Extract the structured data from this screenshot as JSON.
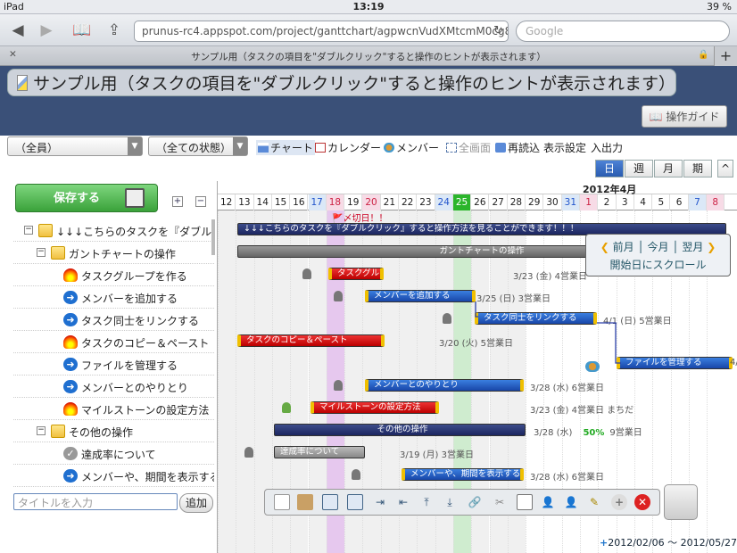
{
  "statusbar": {
    "device": "iPad",
    "time": "13:19",
    "battery": "39 %"
  },
  "browser": {
    "url": "prunus-rc4.appspot.com/project/ganttchart/agpwcnVudXMtcmM0cg8LE",
    "search_placeholder": "Google",
    "tab_title": "サンプル用（タスクの項目を\"ダブルクリック\"すると操作のヒントが表示されます）"
  },
  "banner": {
    "title": "サンプル用（タスクの項目を\"ダブルクリック\"すると操作のヒントが表示されます）",
    "guide_label": "操作ガイド"
  },
  "toolbar": {
    "member_filter": "（全員）",
    "status_filter": "（全ての状態）",
    "chart": "チャート",
    "calendar": "カレンダー",
    "member": "メンバー",
    "fullscreen": "全画面",
    "reload": "再読込",
    "display_settings": "表示設定",
    "import_export": "入出力",
    "views": [
      "日",
      "週",
      "月",
      "期"
    ],
    "collapse": "^"
  },
  "left": {
    "save_label": "保存する",
    "expand_label": "+",
    "collapse_label": "−",
    "title_placeholder": "タイトルを入力",
    "add_label": "追加"
  },
  "tree": [
    {
      "label": "↓↓↓こちらのタスクを『ダブル",
      "type": "group",
      "indent": 0
    },
    {
      "label": "ガントチャートの操作",
      "type": "group",
      "indent": 1
    },
    {
      "label": "タスクグループを作る",
      "type": "fire",
      "indent": 2
    },
    {
      "label": "メンバーを追加する",
      "type": "arrow",
      "indent": 2
    },
    {
      "label": "タスク同士をリンクする",
      "type": "arrow",
      "indent": 2
    },
    {
      "label": "タスクのコピー＆ペースト",
      "type": "fire",
      "indent": 2
    },
    {
      "label": "ファイルを管理する",
      "type": "arrow",
      "indent": 2
    },
    {
      "label": "メンバーとのやりとり",
      "type": "arrow",
      "indent": 2
    },
    {
      "label": "マイルストーンの設定方法",
      "type": "fire",
      "indent": 2
    },
    {
      "label": "その他の操作",
      "type": "group",
      "indent": 1
    },
    {
      "label": "達成率について",
      "type": "check",
      "indent": 2
    },
    {
      "label": "メンバーや、期間を表示する",
      "type": "arrow",
      "indent": 2
    }
  ],
  "chart": {
    "month_label": "2012年4月",
    "days": [
      "12",
      "13",
      "14",
      "15",
      "16",
      "17",
      "18",
      "19",
      "20",
      "21",
      "22",
      "23",
      "24",
      "25",
      "26",
      "27",
      "28",
      "29",
      "30",
      "31",
      "1",
      "2",
      "3",
      "4",
      "5",
      "6",
      "7",
      "8"
    ],
    "milestone_label": "〆切日！！",
    "bars": [
      {
        "label": "↓↓↓こちらのタスクを『ダブルクリック』すると操作方法を見ることができます！！！",
        "style": "dark",
        "info": ""
      },
      {
        "label": "ガントチャートの操作",
        "style": "gray",
        "info": ""
      },
      {
        "label": "タスクグループを作る",
        "style": "red",
        "info": "3/23 (金)  4営業日"
      },
      {
        "label": "メンバーを追加する",
        "style": "blue",
        "info": "3/25 (日)  3営業日"
      },
      {
        "label": "タスク同士をリンクする",
        "style": "blue",
        "info": "4/1 (日)  5営業日"
      },
      {
        "label": "タスクのコピー＆ペースト",
        "style": "red",
        "info": "3/20 (火)  5営業日"
      },
      {
        "label": "ファイルを管理する",
        "style": "blue",
        "info": "4/"
      },
      {
        "label": "メンバーとのやりとり",
        "style": "blue",
        "info": "3/28 (水)  6営業日"
      },
      {
        "label": "マイルストーンの設定方法",
        "style": "red",
        "info": "3/23 (金)  4営業日  まちだ"
      },
      {
        "label": "その他の操作",
        "style": "dark",
        "info": "3/28 (水)",
        "pct": "50%",
        "info2": "9営業日"
      },
      {
        "label": "達成率について",
        "style": "lgray",
        "info": "3/19 (月)  3営業日"
      },
      {
        "label": "メンバーや、期間を表示する",
        "style": "blue",
        "info": "3/28 (水)  6営業日"
      }
    ],
    "scroll_panel": {
      "prev": "前月",
      "current": "今月",
      "next": "翌月",
      "start": "開始日にスクロール"
    },
    "date_range": "2012/02/06 〜 2012/05/27"
  },
  "colors": {
    "banner": "#3a5078",
    "today": "#2bb52b",
    "accent_blue": "#1846a8"
  }
}
